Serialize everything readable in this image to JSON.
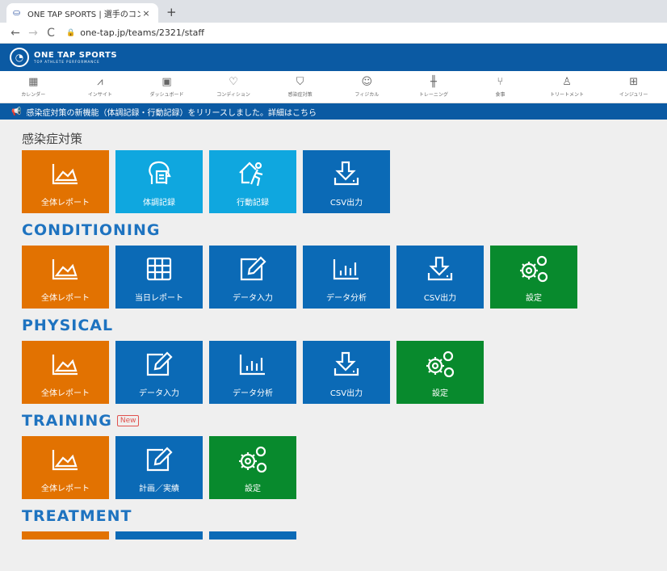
{
  "browser": {
    "tab_title": "ONE TAP SPORTS | 選手のコンディ",
    "tab_close": "×",
    "new_tab": "+",
    "back": "←",
    "forward": "→",
    "reload": "C",
    "url": "one-tap.jp/teams/2321/staff"
  },
  "app": {
    "logo_main": "ONE TAP SPORTS",
    "logo_sub": "TOP ATHLETE PERFORMANCE"
  },
  "nav": [
    {
      "label": "カレンダー",
      "icon": "calendar-icon",
      "glyph": "▦"
    },
    {
      "label": "インサイト",
      "icon": "insight-chart-icon",
      "glyph": "⩘"
    },
    {
      "label": "ダッシュボード",
      "icon": "dashboard-icon",
      "glyph": "▣"
    },
    {
      "label": "コンディション",
      "icon": "heart-pulse-icon",
      "glyph": "♡"
    },
    {
      "label": "感染症対策",
      "icon": "shield-icon",
      "glyph": "⛉"
    },
    {
      "label": "フィジカル",
      "icon": "person-icon",
      "glyph": "☺"
    },
    {
      "label": "トレーニング",
      "icon": "dumbbell-icon",
      "glyph": "╫"
    },
    {
      "label": "食事",
      "icon": "fork-knife-icon",
      "glyph": "⑂"
    },
    {
      "label": "トリートメント",
      "icon": "treatment-icon",
      "glyph": "♙"
    },
    {
      "label": "インジュリー",
      "icon": "first-aid-icon",
      "glyph": "⊞"
    }
  ],
  "announcement": "感染症対策の新機能（体調記録・行動記録）をリリースしました。詳細はこちら",
  "sections": {
    "infection": {
      "title": "感染症対策",
      "tiles": [
        "全体レポート",
        "体調記録",
        "行動記録",
        "CSV出力"
      ]
    },
    "conditioning": {
      "title": "CONDITIONING",
      "tiles": [
        "全体レポート",
        "当日レポート",
        "データ入力",
        "データ分析",
        "CSV出力",
        "設定"
      ]
    },
    "physical": {
      "title": "PHYSICAL",
      "tiles": [
        "全体レポート",
        "データ入力",
        "データ分析",
        "CSV出力",
        "設定"
      ]
    },
    "training": {
      "title": "TRAINING",
      "badge": "New",
      "tiles": [
        "全体レポート",
        "計画／実績",
        "設定"
      ]
    },
    "treatment": {
      "title": "TREATMENT"
    }
  },
  "colors": {
    "orange": "#e27201",
    "blue": "#0b6ab6",
    "sky": "#0fa7df",
    "green": "#088a2d",
    "header_blue": "#0b5aa3"
  }
}
